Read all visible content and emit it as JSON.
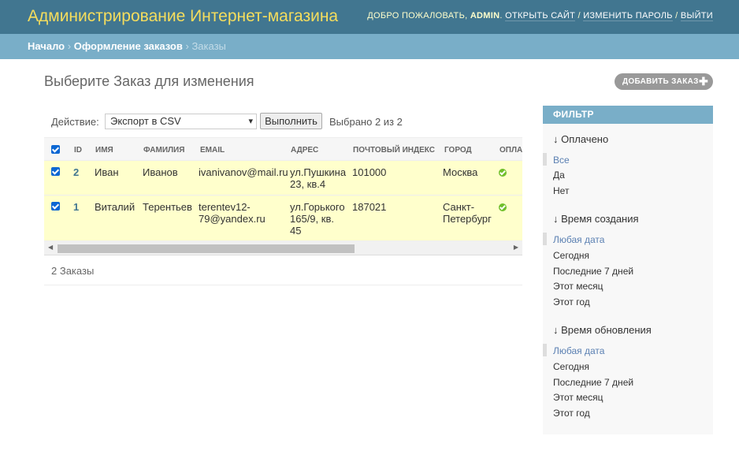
{
  "header": {
    "title": "Администрирование Интернет-магазина",
    "welcome": "Добро пожаловать,",
    "user": "admin",
    "links": [
      "Открыть сайт",
      "Изменить пароль",
      "Выйти"
    ]
  },
  "breadcrumbs": [
    "Начало",
    "Оформление заказов",
    "Заказы"
  ],
  "page": {
    "title": "Выберите Заказ для изменения",
    "add_button": "Добавить Заказ"
  },
  "actions": {
    "label": "Действие:",
    "selected": "Экспорт в CSV",
    "go_button": "Выполнить",
    "counter": "Выбрано 2 из 2"
  },
  "table": {
    "columns": [
      "ID",
      "Имя",
      "Фамилия",
      "Email",
      "Адрес",
      "Почтовый индекс",
      "Город",
      "Оплачено"
    ],
    "rows": [
      {
        "id": "2",
        "first_name": "Иван",
        "last_name": "Иванов",
        "email": [
          "ivanivanov@mail.ru"
        ],
        "address": [
          "ул.Пушкина",
          "23, кв.4"
        ],
        "postal_code": "101000",
        "city": [
          "Москва"
        ],
        "paid": true
      },
      {
        "id": "1",
        "first_name": "Виталий",
        "last_name": "Терентьев",
        "email": [
          "terentev12-",
          "79@yandex.ru"
        ],
        "address": [
          "ул.Горького",
          "165/9, кв.",
          "45"
        ],
        "postal_code": "187021",
        "city": [
          "Санкт-",
          "Петербург"
        ],
        "paid": true
      }
    ]
  },
  "paginator": "2 Заказы",
  "filter": {
    "title": "Фильтр",
    "groups": [
      {
        "title": "↓ Оплачено",
        "options": [
          "Все",
          "Да",
          "Нет"
        ],
        "selected": 0
      },
      {
        "title": "↓ Время создания",
        "options": [
          "Любая дата",
          "Сегодня",
          "Последние 7 дней",
          "Этот месяц",
          "Этот год"
        ],
        "selected": 0
      },
      {
        "title": "↓ Время обновления",
        "options": [
          "Любая дата",
          "Сегодня",
          "Последние 7 дней",
          "Этот месяц",
          "Этот год"
        ],
        "selected": 0
      }
    ]
  },
  "colors": {
    "header_bg": "#417690",
    "branding": "#f5dd5d",
    "breadcrumbs_bg": "#79aec8",
    "selected_row_bg": "#ffffcc",
    "link": "#417690",
    "filter_selected": "#5b80b2",
    "paid_icon": "#70bf2b"
  },
  "icons": {
    "add": "plus-icon",
    "paid": "check-circle-icon",
    "select": "chevron-down-icon",
    "checkbox": "checkbox-checked-icon"
  }
}
